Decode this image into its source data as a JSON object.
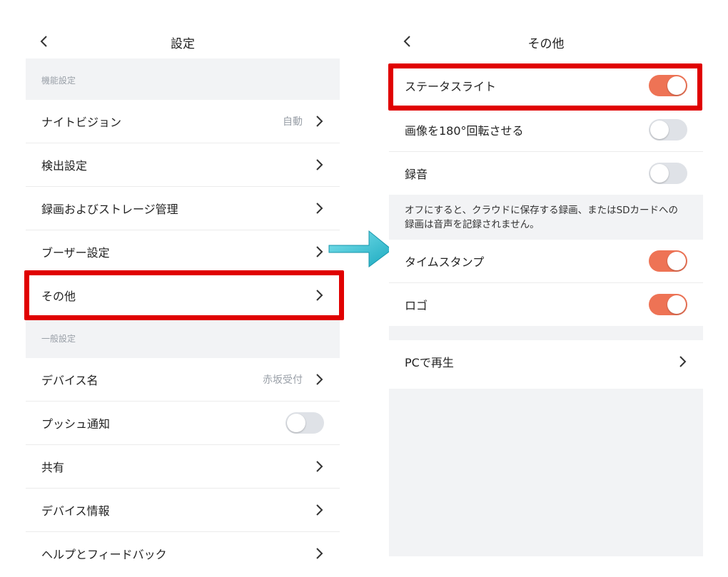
{
  "left_screen": {
    "title": "設定",
    "sections": [
      {
        "header": "機能設定",
        "rows": [
          {
            "label": "ナイトビジョン",
            "value": "自動"
          },
          {
            "label": "検出設定"
          },
          {
            "label": "録画およびストレージ管理"
          },
          {
            "label": "ブーザー設定"
          },
          {
            "label": "その他"
          }
        ]
      },
      {
        "header": "一般設定",
        "rows": [
          {
            "label": "デバイス名",
            "value": "赤坂受付"
          },
          {
            "label": "プッシュ通知",
            "toggle": false
          },
          {
            "label": "共有"
          },
          {
            "label": "デバイス情報"
          },
          {
            "label": "ヘルプとフィードバック"
          }
        ]
      }
    ]
  },
  "right_screen": {
    "title": "その他",
    "rows": [
      {
        "label": "ステータスライト",
        "toggle": true
      },
      {
        "label": "画像を180°回転させる",
        "toggle": false
      },
      {
        "label": "録音",
        "toggle": false
      }
    ],
    "note": "オフにすると、クラウドに保存する録画、またはSDカードへの録画は音声を記録されません。",
    "rows2": [
      {
        "label": "タイムスタンプ",
        "toggle": true
      },
      {
        "label": "ロゴ",
        "toggle": true
      }
    ],
    "pc_row": {
      "label": "PCで再生"
    }
  },
  "colors": {
    "highlight": "#e00000",
    "toggle_on": "#ee7355",
    "toggle_off": "#dfe2e7",
    "arrow": "#2cc3d6"
  }
}
